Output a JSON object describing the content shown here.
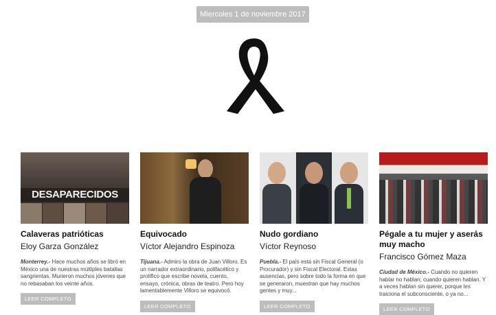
{
  "date": "Miercoles 1 de noviembre 2017",
  "colors": {
    "badge": "#bdbdbd",
    "ribbon": "#111111"
  },
  "articles": [
    {
      "title": "Calaveras patrióticas",
      "author": "Eloy Garza González",
      "image_text": "DESAPARECIDOS",
      "location": "Monterrey.-",
      "excerpt": " Hace muchos años se libró en México una de nuestras múltiples batallas sangrientas. Murieron muchos jóvenes que no rebasaban los veinte años.",
      "button": "LEER COMPLETO"
    },
    {
      "title": "Equivocado",
      "author": "Víctor Alejandro Espinoza",
      "location": "Tijuana.-",
      "excerpt": " Admiro la obra de Juan Villoro. Es un narrador extraordinario, polifacético y prolífico que escribe novela, cuento, ensayo, crónica, obras de teatro. Pero hoy lamentablemente Villoro se equivocó.",
      "button": "LEER COMPLETO"
    },
    {
      "title": "Nudo gordiano",
      "author": "Víctor Reynoso",
      "location": "Puebla.-",
      "excerpt": " El país está sin Fiscal General (o Procurador) y sin Fiscal Electoral. Estas ausencias, pero sobre todo la forma en que se generaron, muestran que hay muchos gentes y muy...",
      "button": "LEER COMPLETO"
    },
    {
      "title": "Pégale a tu mujer y aserás muy macho",
      "author": "Francisco Gómez Maza",
      "location": "Ciudad de México.-",
      "excerpt": " Cuando no quieren hablar no hablan; cuando quieren hablan. Y a veces hablan sin querer, porque les traiciona el subconsciente, o ya no...",
      "button": "LEER COMPLETO"
    }
  ]
}
